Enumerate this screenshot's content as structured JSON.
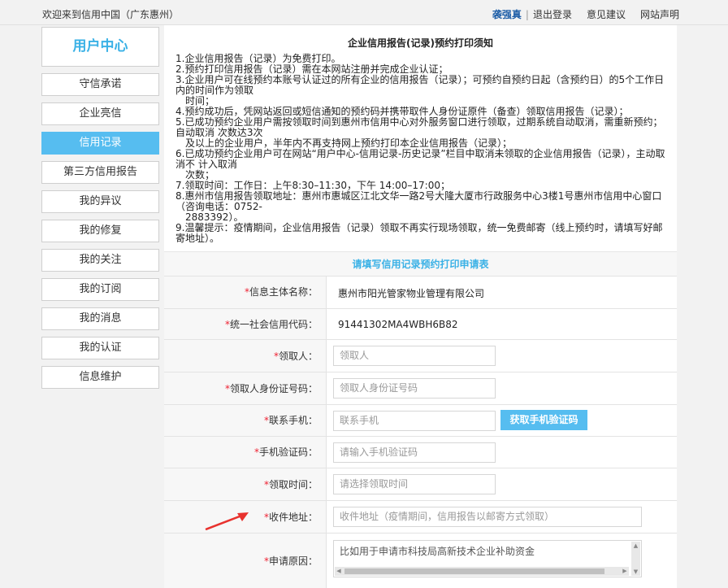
{
  "topbar": {
    "welcome": "欢迎来到信用中国（广东惠州）",
    "user": "袭强真",
    "logout": "退出登录",
    "feedback": "意见建议",
    "statement": "网站声明"
  },
  "sidebar": {
    "title": "用户中心",
    "items": [
      {
        "label": "守信承诺"
      },
      {
        "label": "企业亮信"
      },
      {
        "label": "信用记录"
      },
      {
        "label": "第三方信用报告"
      },
      {
        "label": "我的异议"
      },
      {
        "label": "我的修复"
      },
      {
        "label": "我的关注"
      },
      {
        "label": "我的订阅"
      },
      {
        "label": "我的消息"
      },
      {
        "label": "我的认证"
      },
      {
        "label": "信息维护"
      }
    ],
    "active_index": 2
  },
  "notice": {
    "title": "企业信用报告(记录)预约打印须知",
    "lines": [
      "1.企业信用报告（记录）为免费打印。",
      "2.预约打印信用报告（记录）需在本网站注册并完成企业认证；",
      "3.企业用户可在线预约本账号认证过的所有企业的信用报告（记录）；可预约自预约日起（含预约日）的5个工作日内的时间作为领取",
      "   时间；",
      "4.预约成功后，凭网站返回或短信通知的预约码并携带取件人身份证原件（备查）领取信用报告（记录）；",
      "5.已成功预约企业用户需按领取时间到惠州市信用中心对外服务窗口进行领取，过期系统自动取消，需重新预约；自动取消 次数达3次",
      "   及以上的企业用户，半年内不再支持网上预约打印本企业信用报告（记录）；",
      "6.已成功预约企业用户可在网站“用户中心-信用记录-历史记录”栏目中取消未领取的企业信用报告（记录），主动取消不 计入取消",
      "   次数；",
      "7.领取时间：工作日：上午8:30–11:30，下午 14:00–17:00；",
      "8.惠州市信用报告领取地址：惠州市惠城区江北文华一路2号大隆大厦市行政服务中心3楼1号惠州市信用中心窗口（咨询电话：0752-",
      "   2883392）。",
      "9.温馨提示：疫情期间，企业信用报告（记录）领取不再实行现场领取，统一免费邮寄（线上预约时，请填写好邮寄地址）。"
    ]
  },
  "form": {
    "heading": "请填写信用记录预约打印申请表",
    "star": "*",
    "fields": {
      "entity_name": {
        "label": "信息主体名称：",
        "value": "惠州市阳光管家物业管理有限公司"
      },
      "credit_code": {
        "label": "统一社会信用代码：",
        "value": "91441302MA4WBH6B82"
      },
      "receiver": {
        "label": "领取人：",
        "placeholder": "领取人"
      },
      "receiver_id": {
        "label": "领取人身份证号码：",
        "placeholder": "领取人身份证号码"
      },
      "phone": {
        "label": "联系手机：",
        "placeholder": "联系手机",
        "button": "获取手机验证码"
      },
      "sms_code": {
        "label": "手机验证码：",
        "placeholder": "请输入手机验证码"
      },
      "pickup_time": {
        "label": "领取时间：",
        "placeholder": "请选择领取时间"
      },
      "address": {
        "label": "收件地址：",
        "placeholder": "收件地址（疫情期间，信用报告以邮寄方式领取）"
      },
      "reason": {
        "label": "申请原因：",
        "value": "比如用于申请市科技局高新技术企业补助资金"
      }
    }
  },
  "colors": {
    "accent": "#56bdf0",
    "title_blue": "#3ab1e6",
    "arrow_red": "#e8322e"
  }
}
